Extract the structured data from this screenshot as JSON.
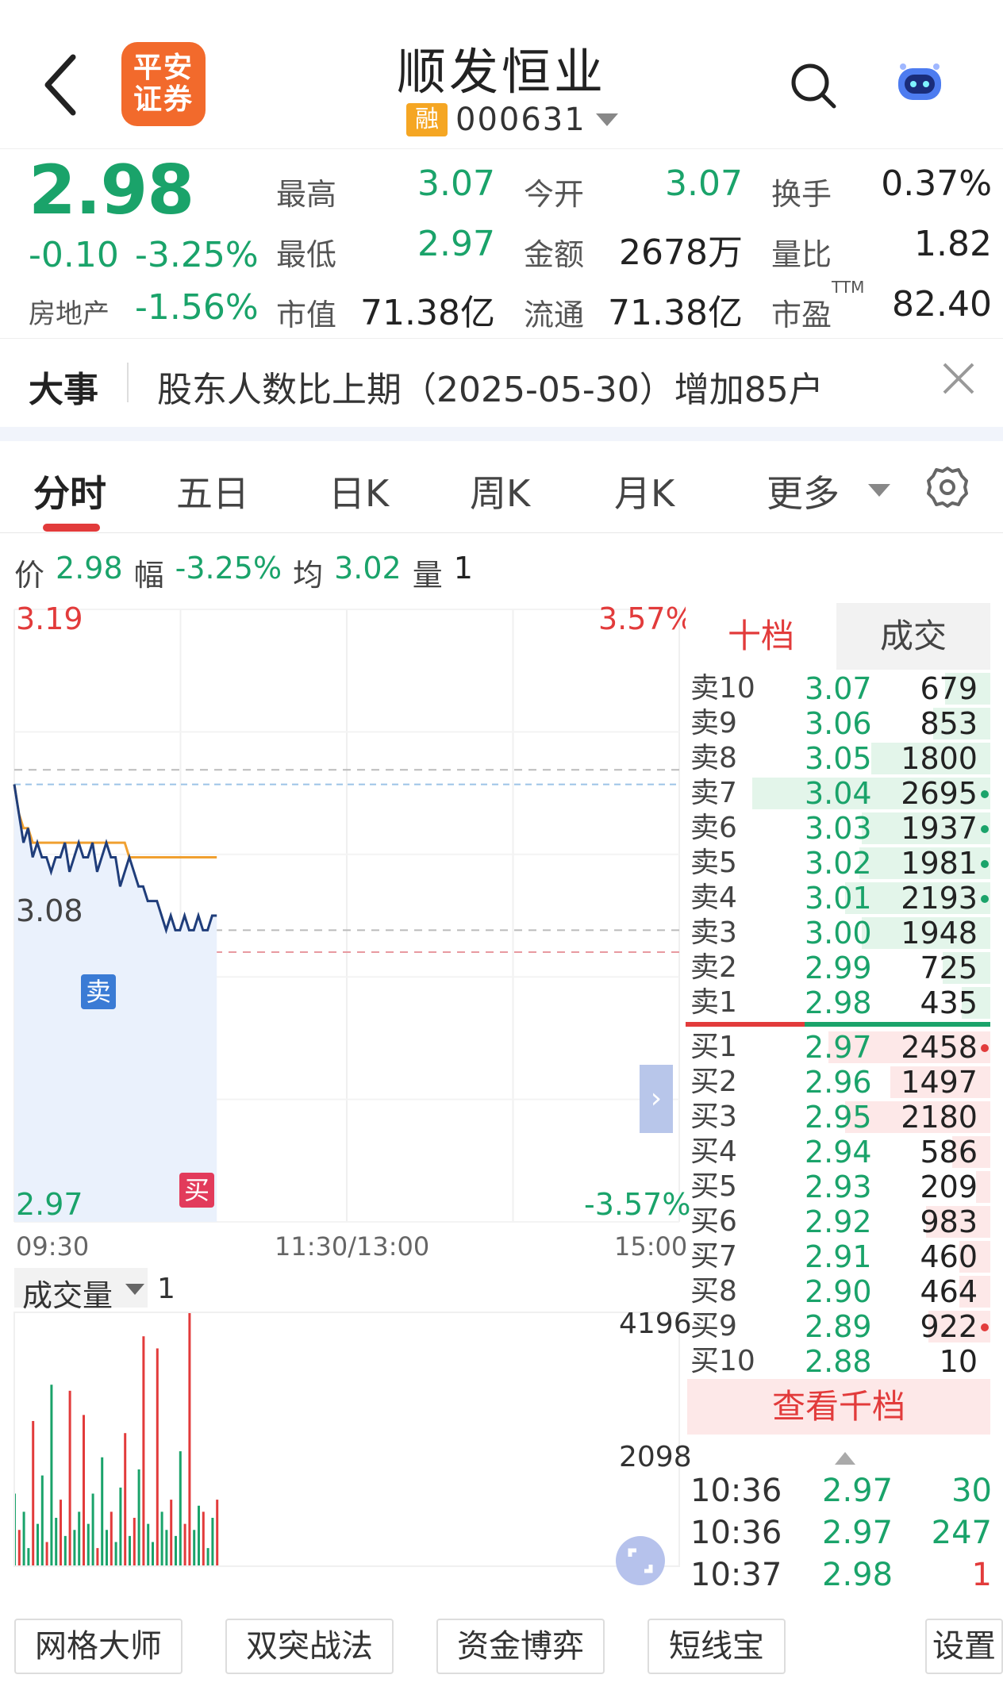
{
  "header": {
    "title": "顺发恒业",
    "logo_text": "平安证券",
    "rong_badge": "融",
    "code": "000631"
  },
  "quote": {
    "price": "2.98",
    "change": "-0.10",
    "change_pct": "-3.25%",
    "sector_name": "房地产",
    "sector_pct": "-1.56%",
    "high_label": "最高",
    "high": "3.07",
    "open_label": "今开",
    "open": "3.07",
    "turnover_label": "换手",
    "turnover": "0.37%",
    "low_label": "最低",
    "low": "2.97",
    "amount_label": "金额",
    "amount": "2678万",
    "vol_ratio_label": "量比",
    "vol_ratio": "1.82",
    "mcap_label": "市值",
    "mcap": "71.38亿",
    "float_label": "流通",
    "float": "71.38亿",
    "pe_label": "市盈",
    "pe_sup": "TTM",
    "pe": "82.40"
  },
  "news": {
    "tag": "大事",
    "text": "股东人数比上期（2025-05-30）增加85户"
  },
  "tabs": [
    "分时",
    "五日",
    "日K",
    "周K",
    "月K",
    "更多"
  ],
  "info_row": {
    "price_label": "价",
    "price": "2.98",
    "amp_label": "幅",
    "amp": "-3.25%",
    "avg_label": "均",
    "avg": "3.02",
    "vol_label": "量",
    "vol": "1"
  },
  "chart_labels": {
    "top_price": "3.19",
    "top_pct": "3.57%",
    "mid_price": "3.08",
    "bottom_price": "2.97",
    "bottom_pct": "-3.57%",
    "time_start": "09:30",
    "time_mid": "11:30/13:00",
    "time_end": "15:00",
    "sell_marker": "卖",
    "buy_marker": "买",
    "volume_selector": "成交量",
    "volume_value": "1",
    "vol_top": "4196",
    "vol_mid": "2098"
  },
  "chart_data": {
    "type": "line",
    "x_range": [
      "09:30",
      "15:00"
    ],
    "ylim": [
      2.77,
      3.19
    ],
    "series": [
      {
        "values": [
          3.07,
          3.05,
          3.03,
          3.04,
          3.02,
          3.03,
          3.02,
          3.02,
          3.01,
          3.02,
          3.02,
          3.03,
          3.01,
          3.02,
          3.03,
          3.02,
          3.02,
          3.03,
          3.01,
          3.02,
          3.03,
          3.02,
          3.02,
          3.0,
          3.01,
          3.02,
          3.01,
          3.0,
          3.0,
          2.99,
          2.99,
          2.99,
          2.98,
          2.97,
          2.98,
          2.97,
          2.97,
          2.98,
          2.97,
          2.97,
          2.98,
          2.97,
          2.97,
          2.98,
          2.98
        ]
      },
      {
        "values": [
          3.07,
          3.05,
          3.04,
          3.04,
          3.03,
          3.03,
          3.03,
          3.03,
          3.03,
          3.03,
          3.03,
          3.03,
          3.03,
          3.03,
          3.03,
          3.03,
          3.03,
          3.03,
          3.03,
          3.03,
          3.03,
          3.03,
          3.03,
          3.03,
          3.03,
          3.02,
          3.02,
          3.02,
          3.02,
          3.02,
          3.02,
          3.02,
          3.02,
          3.02,
          3.02,
          3.02,
          3.02,
          3.02,
          3.02,
          3.02,
          3.02,
          3.02,
          3.02,
          3.02,
          3.02
        ]
      }
    ],
    "volume": {
      "ylim": [
        0,
        4196
      ],
      "values": [
        1200,
        600,
        900,
        300,
        2400,
        700,
        1500,
        400,
        3000,
        800,
        1100,
        500,
        2900,
        600,
        900,
        2500,
        700,
        1200,
        300,
        1800,
        600,
        900,
        400,
        1300,
        2200,
        500,
        800,
        1600,
        3800,
        700,
        400,
        3600,
        900,
        600,
        1100,
        500,
        1900,
        700,
        4196,
        600,
        1000,
        900,
        300,
        800,
        1100
      ],
      "colors": [
        "green",
        "red",
        "green",
        "green",
        "red",
        "green",
        "green",
        "red",
        "green",
        "green",
        "red",
        "green",
        "red",
        "green",
        "green",
        "red",
        "green",
        "green",
        "red",
        "green",
        "green",
        "red",
        "green",
        "green",
        "red",
        "green",
        "red",
        "green",
        "red",
        "green",
        "green",
        "red",
        "green",
        "green",
        "red",
        "green",
        "green",
        "red",
        "red",
        "green",
        "green",
        "red",
        "green",
        "green",
        "red"
      ]
    }
  },
  "order_book": {
    "tab_left": "十档",
    "tab_right": "成交",
    "sells": [
      {
        "label": "卖10",
        "price": "3.07",
        "vol": "679",
        "bar": 0.19,
        "dot": ""
      },
      {
        "label": "卖9",
        "price": "3.06",
        "vol": "853",
        "bar": 0.24,
        "dot": ""
      },
      {
        "label": "卖8",
        "price": "3.05",
        "vol": "1800",
        "bar": 0.5,
        "dot": ""
      },
      {
        "label": "卖7",
        "price": "3.04",
        "vol": "2695",
        "bar": 1.0,
        "dot": "green"
      },
      {
        "label": "卖6",
        "price": "3.03",
        "vol": "1937",
        "bar": 0.54,
        "dot": "green"
      },
      {
        "label": "卖5",
        "price": "3.02",
        "vol": "1981",
        "bar": 0.55,
        "dot": "green"
      },
      {
        "label": "卖4",
        "price": "3.01",
        "vol": "2193",
        "bar": 0.61,
        "dot": "green"
      },
      {
        "label": "卖3",
        "price": "3.00",
        "vol": "1948",
        "bar": 0.54,
        "dot": ""
      },
      {
        "label": "卖2",
        "price": "2.99",
        "vol": "725",
        "bar": 0.2,
        "dot": ""
      },
      {
        "label": "卖1",
        "price": "2.98",
        "vol": "435",
        "bar": 0.12,
        "dot": ""
      }
    ],
    "buys": [
      {
        "label": "买1",
        "price": "2.97",
        "vol": "2458",
        "bar": 0.68,
        "dot": "red"
      },
      {
        "label": "买2",
        "price": "2.96",
        "vol": "1497",
        "bar": 0.42,
        "dot": ""
      },
      {
        "label": "买3",
        "price": "2.95",
        "vol": "2180",
        "bar": 0.61,
        "dot": ""
      },
      {
        "label": "买4",
        "price": "2.94",
        "vol": "586",
        "bar": 0.16,
        "dot": ""
      },
      {
        "label": "买5",
        "price": "2.93",
        "vol": "209",
        "bar": 0.06,
        "dot": ""
      },
      {
        "label": "买6",
        "price": "2.92",
        "vol": "983",
        "bar": 0.27,
        "dot": ""
      },
      {
        "label": "买7",
        "price": "2.91",
        "vol": "460",
        "bar": 0.13,
        "dot": ""
      },
      {
        "label": "买8",
        "price": "2.90",
        "vol": "464",
        "bar": 0.13,
        "dot": ""
      },
      {
        "label": "买9",
        "price": "2.89",
        "vol": "922",
        "bar": 0.26,
        "dot": "red"
      },
      {
        "label": "买10",
        "price": "2.88",
        "vol": "10",
        "bar": 0.0,
        "dot": ""
      }
    ],
    "view_more": "查看千档",
    "trades": [
      {
        "time": "10:36",
        "price": "2.97",
        "vol": "30",
        "color": "green"
      },
      {
        "time": "10:36",
        "price": "2.97",
        "vol": "247",
        "color": "green"
      },
      {
        "time": "10:37",
        "price": "2.98",
        "vol": "1",
        "color": "red"
      }
    ]
  },
  "bottom_tools": [
    "网格大师",
    "双突战法",
    "资金博弈",
    "短线宝",
    "设置"
  ],
  "colors": {
    "up": "#e23b3b",
    "down": "#1aa36a",
    "avg_line": "#f0a030",
    "price_line": "#1f3d7a",
    "accent": "#f26a2c"
  }
}
